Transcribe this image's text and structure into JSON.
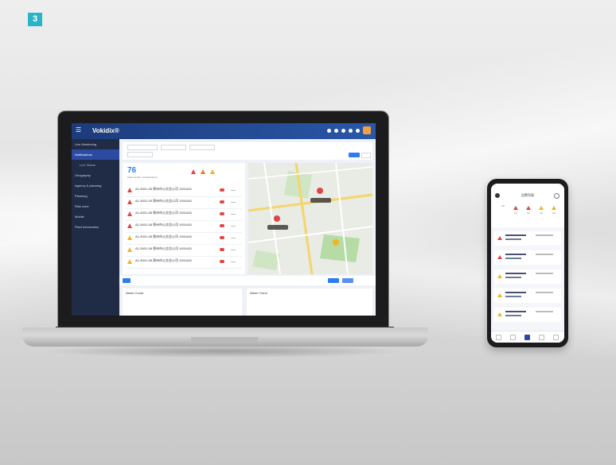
{
  "badge_number": "3",
  "laptop_app": {
    "brand": "Vokidix®",
    "sidebar": {
      "items": [
        {
          "label": "Live Monitoring",
          "active": false
        },
        {
          "label": "Notifications",
          "active": true
        },
        {
          "label": "Live Status",
          "sub": true
        },
        {
          "label": "Geography",
          "active": false
        },
        {
          "label": "Agency & planning",
          "active": false
        },
        {
          "label": "Planning",
          "active": false
        },
        {
          "label": "Risk zone",
          "active": false
        },
        {
          "label": "Mobile",
          "active": false
        },
        {
          "label": "Fleet Information",
          "active": false
        }
      ]
    },
    "list": {
      "count": "76",
      "count_subtitle": "Total number of Notifications",
      "rows": [
        {
          "title": "A1-5001-08 郑州市公交总公司 1001A01",
          "level": "red"
        },
        {
          "title": "A1-5001-09 郑州市公交总公司 1001A01",
          "level": "red"
        },
        {
          "title": "A1-5001-08 郑州市公交总公司 1001A01",
          "level": "red"
        },
        {
          "title": "A1-5001-08 郑州市公交总公司 1001A01",
          "level": "red"
        },
        {
          "title": "A1-5001-08 郑州市公交总公司 1001A01",
          "level": "yellow"
        },
        {
          "title": "A1-5001-08 郑州市公交总公司 1001A01",
          "level": "yellow"
        },
        {
          "title": "A1-5001-08 郑州市公交总公司 1001A01",
          "level": "yellow"
        }
      ]
    },
    "bottom_panels": {
      "left_title": "Alarm Count",
      "right_title": "Alarm Trend"
    }
  },
  "phone_app": {
    "title": "告警列表",
    "stats": [
      {
        "label": "All",
        "level": "all"
      },
      {
        "label": "L1",
        "level": "red"
      },
      {
        "label": "L2",
        "level": "red"
      },
      {
        "label": "L3",
        "level": "yellow"
      },
      {
        "label": "L4",
        "level": "yellow"
      }
    ],
    "cards": [
      {
        "level": "red"
      },
      {
        "level": "red"
      },
      {
        "level": "yellow"
      },
      {
        "level": "yellow"
      },
      {
        "level": "yellow"
      }
    ]
  }
}
